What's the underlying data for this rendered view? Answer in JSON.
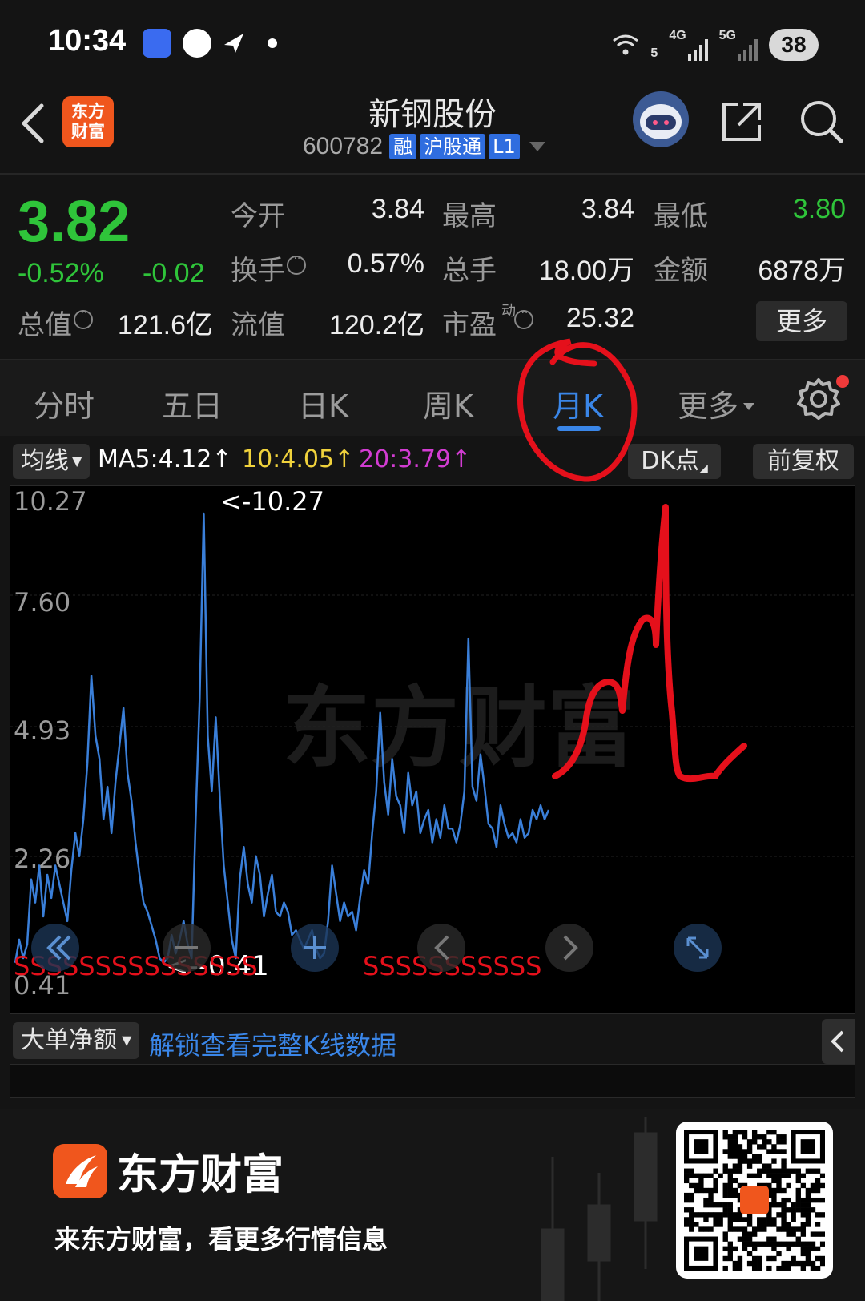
{
  "status_bar": {
    "time": "10:34",
    "network_1": "5",
    "network_2": "4G",
    "network_3": "5G",
    "battery": "38"
  },
  "header": {
    "app_logo_text_line1": "东方",
    "app_logo_text_line2": "财富",
    "stock_name": "新钢股份",
    "stock_code": "600782",
    "badges": [
      "融",
      "沪股通",
      "L1"
    ]
  },
  "quote": {
    "price": "3.82",
    "change_pct": "-0.52%",
    "change_abs": "-0.02",
    "open_label": "今开",
    "open_value": "3.84",
    "high_label": "最高",
    "high_value": "3.84",
    "low_label": "最低",
    "low_value": "3.80",
    "turnover_label": "换手",
    "turnover_value": "0.57%",
    "volume_label": "总手",
    "volume_value": "18.00万",
    "amount_label": "金额",
    "amount_value": "6878万",
    "mktcap_label": "总值",
    "mktcap_value": "121.6亿",
    "float_label": "流值",
    "float_value": "120.2亿",
    "pe_label": "市盈",
    "pe_sup": "动",
    "pe_value": "25.32",
    "more_label": "更多"
  },
  "tabs": [
    {
      "label": "分时"
    },
    {
      "label": "五日"
    },
    {
      "label": "日K"
    },
    {
      "label": "周K"
    },
    {
      "label": "月K",
      "active": true
    },
    {
      "label": "更多"
    }
  ],
  "ma_row": {
    "select_label": "均线",
    "ma5": "MA5:4.12",
    "ma10": "10:4.05",
    "ma20": "20:3.79",
    "dk_label": "DK点",
    "adjust_label": "前复权",
    "colors": {
      "ma5": "#ffffff",
      "ma10": "#f0d23c",
      "ma20": "#d23cd2"
    }
  },
  "chart_data": {
    "type": "line",
    "y_ticks": [
      "10.27",
      "7.60",
      "4.93",
      "2.26",
      "0.41"
    ],
    "max_label": "<-10.27",
    "min_label": "<--0.41",
    "series": [
      {
        "color": "#3a7fd9",
        "values": [
          0.5,
          1.0,
          0.6,
          0.9,
          2.3,
          1.8,
          2.6,
          1.5,
          2.4,
          1.9,
          2.6,
          2.2,
          1.8,
          1.4,
          2.5,
          3.3,
          2.8,
          3.6,
          4.8,
          6.7,
          5.4,
          4.9,
          3.6,
          4.3,
          3.3,
          4.4,
          5.2,
          6.0,
          4.6,
          4.0,
          3.1,
          2.4,
          1.8,
          1.6,
          1.3,
          1.0,
          0.6,
          0.5,
          0.6,
          1.1,
          0.7,
          1.0,
          1.4,
          0.9,
          0.6,
          3.6,
          6.2,
          10.2,
          5.4,
          4.2,
          5.8,
          4.1,
          2.6,
          1.8,
          1.0,
          0.6,
          2.3,
          3.0,
          2.2,
          1.8,
          2.8,
          2.4,
          1.5,
          2.0,
          2.4,
          1.6,
          1.5,
          1.8,
          1.6,
          1.1,
          1.2,
          1.0,
          0.8,
          1.0,
          1.2,
          0.8,
          0.6,
          0.7,
          1.4,
          2.6,
          2.0,
          1.4,
          1.8,
          1.5,
          1.6,
          1.2,
          1.9,
          2.5,
          2.2,
          3.3,
          4.2,
          5.9,
          4.4,
          3.7,
          4.9,
          4.1,
          3.9,
          3.3,
          4.6,
          3.9,
          4.2,
          3.3,
          3.6,
          3.8,
          3.1,
          3.6,
          3.2,
          3.9,
          3.4,
          3.4,
          3.1,
          3.5,
          4.2,
          7.5,
          4.3,
          4.0,
          5.0,
          4.3,
          3.5,
          3.4,
          3.0,
          3.9,
          3.5,
          3.2,
          3.3,
          3.1,
          3.6,
          3.2,
          3.3,
          3.8,
          3.6,
          3.9,
          3.6,
          3.8
        ]
      }
    ],
    "signal_marks_left": "SSSSSSSSSSSSSSS",
    "signal_marks_right": "SSSSSSSSSSS"
  },
  "flow": {
    "select_label": "大单净额",
    "unlock_text": "解锁查看完整K线数据"
  },
  "banner": {
    "brand_name": "东方财富",
    "slogan": "来东方财富，看更多行情信息"
  },
  "accent_colors": {
    "up_down_green": "#2fc43a",
    "active_blue": "#3a86e8",
    "brand_orange": "#f0561d",
    "annotation_red": "#e5101b"
  }
}
